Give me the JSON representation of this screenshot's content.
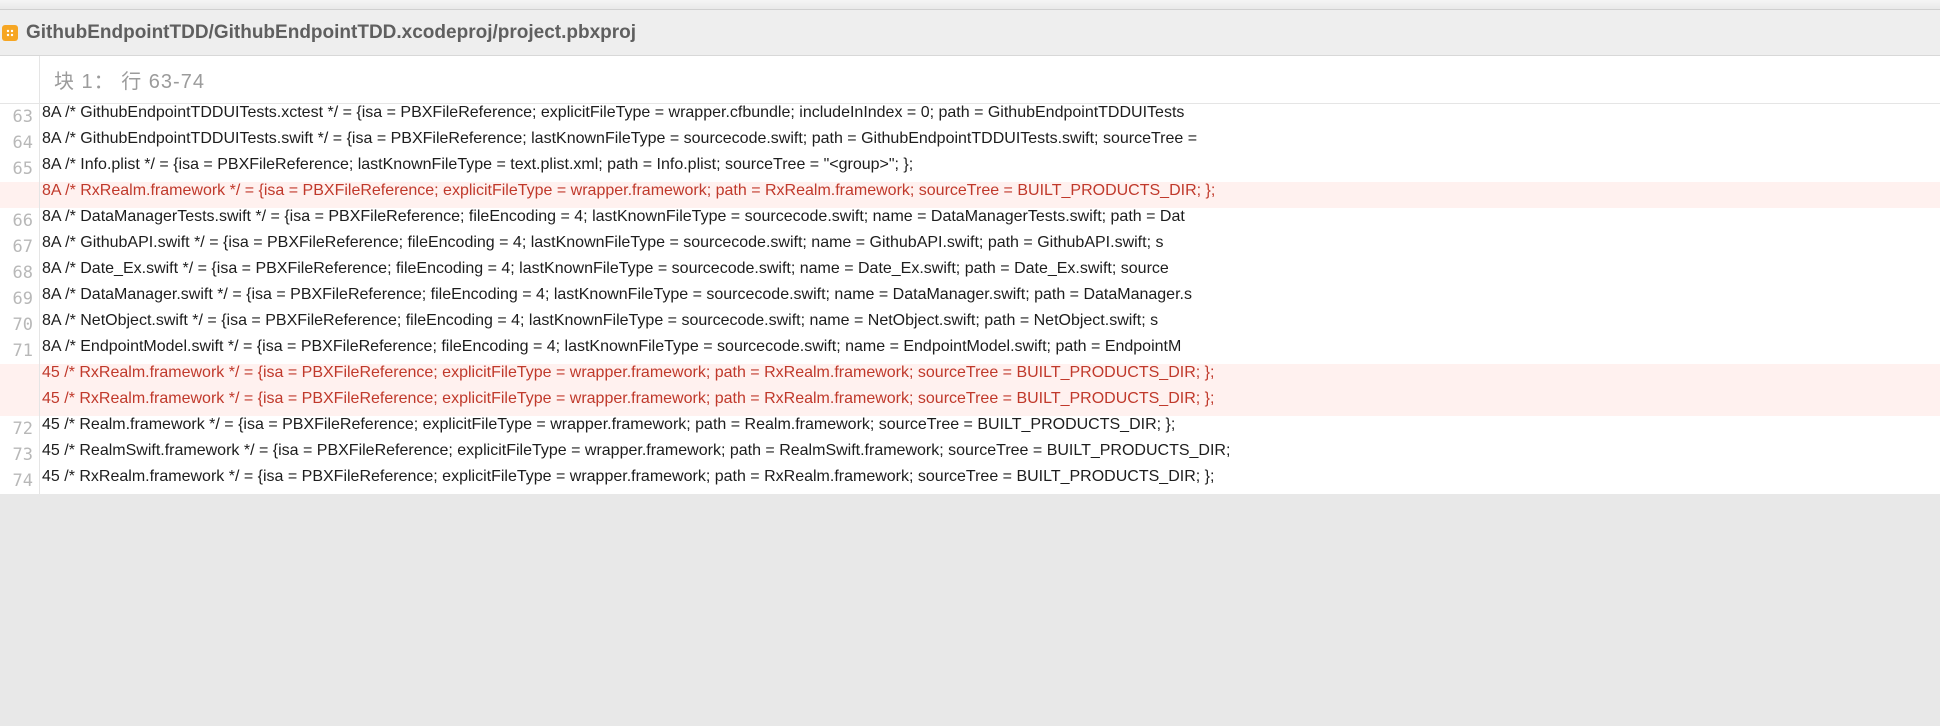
{
  "tab": {
    "title": "GithubEndpointTDD/GithubEndpointTDD.xcodeproj/project.pbxproj"
  },
  "hunk": {
    "label": "块 1：  行 63-74"
  },
  "rows": [
    {
      "ln": "63",
      "type": "ctx",
      "text": "8A /* GithubEndpointTDDUITests.xctest */ = {isa = PBXFileReference; explicitFileType = wrapper.cfbundle; includeInIndex = 0; path = GithubEndpointTDDUITests"
    },
    {
      "ln": "64",
      "type": "ctx",
      "text": "8A /* GithubEndpointTDDUITests.swift */ = {isa = PBXFileReference; lastKnownFileType = sourcecode.swift; path = GithubEndpointTDDUITests.swift; sourceTree = "
    },
    {
      "ln": "65",
      "type": "ctx",
      "text": "8A /* Info.plist */ = {isa = PBXFileReference; lastKnownFileType = text.plist.xml; path = Info.plist; sourceTree = \"<group>\"; };"
    },
    {
      "ln": "",
      "type": "del",
      "text": "8A /* RxRealm.framework */ = {isa = PBXFileReference; explicitFileType = wrapper.framework; path = RxRealm.framework; sourceTree = BUILT_PRODUCTS_DIR; };"
    },
    {
      "ln": "66",
      "type": "ctx",
      "text": "8A /* DataManagerTests.swift */ = {isa = PBXFileReference; fileEncoding = 4; lastKnownFileType = sourcecode.swift; name = DataManagerTests.swift; path = Dat"
    },
    {
      "ln": "67",
      "type": "ctx",
      "text": "8A /* GithubAPI.swift */ = {isa = PBXFileReference; fileEncoding = 4; lastKnownFileType = sourcecode.swift; name = GithubAPI.swift; path = GithubAPI.swift; s"
    },
    {
      "ln": "68",
      "type": "ctx",
      "text": "8A /* Date_Ex.swift */ = {isa = PBXFileReference; fileEncoding = 4; lastKnownFileType = sourcecode.swift; name = Date_Ex.swift; path = Date_Ex.swift; source"
    },
    {
      "ln": "69",
      "type": "ctx",
      "text": "8A /* DataManager.swift */ = {isa = PBXFileReference; fileEncoding = 4; lastKnownFileType = sourcecode.swift; name = DataManager.swift; path = DataManager.s"
    },
    {
      "ln": "70",
      "type": "ctx",
      "text": "8A /* NetObject.swift */ = {isa = PBXFileReference; fileEncoding = 4; lastKnownFileType = sourcecode.swift; name = NetObject.swift; path = NetObject.swift; s"
    },
    {
      "ln": "71",
      "type": "ctx",
      "text": "8A /* EndpointModel.swift */ = {isa = PBXFileReference; fileEncoding = 4; lastKnownFileType = sourcecode.swift; name = EndpointModel.swift; path = EndpointM"
    },
    {
      "ln": "",
      "type": "del",
      "text": "45 /* RxRealm.framework */ = {isa = PBXFileReference; explicitFileType = wrapper.framework; path = RxRealm.framework; sourceTree = BUILT_PRODUCTS_DIR; };"
    },
    {
      "ln": "",
      "type": "del",
      "text": "45 /* RxRealm.framework */ = {isa = PBXFileReference; explicitFileType = wrapper.framework; path = RxRealm.framework; sourceTree = BUILT_PRODUCTS_DIR; };"
    },
    {
      "ln": "72",
      "type": "ctx",
      "text": "45 /* Realm.framework */ = {isa = PBXFileReference; explicitFileType = wrapper.framework; path = Realm.framework; sourceTree = BUILT_PRODUCTS_DIR; };"
    },
    {
      "ln": "73",
      "type": "ctx",
      "text": "45 /* RealmSwift.framework */ = {isa = PBXFileReference; explicitFileType = wrapper.framework; path = RealmSwift.framework; sourceTree = BUILT_PRODUCTS_DIR;"
    },
    {
      "ln": "74",
      "type": "ctx",
      "text": "45 /* RxRealm.framework */ = {isa = PBXFileReference; explicitFileType = wrapper.framework; path = RxRealm.framework; sourceTree = BUILT_PRODUCTS_DIR; };"
    }
  ]
}
